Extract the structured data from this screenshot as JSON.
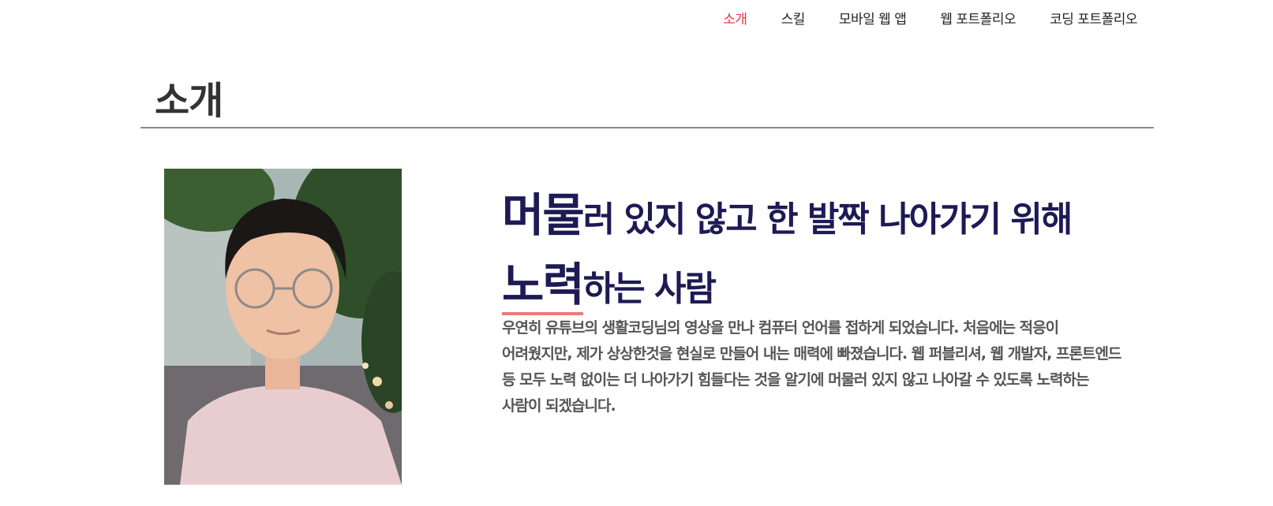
{
  "nav": {
    "items": [
      {
        "label": "소개",
        "active": true
      },
      {
        "label": "스킬",
        "active": false
      },
      {
        "label": "모바일 웹 앱",
        "active": false
      },
      {
        "label": "웹 포트폴리오",
        "active": false
      },
      {
        "label": "코딩 포트폴리오",
        "active": false
      }
    ],
    "active_color": "#e8303f"
  },
  "section": {
    "title": "소개"
  },
  "intro": {
    "headline_line1_emphasis": "머물",
    "headline_line1_rest": "러 있지 않고 한 발짝 나아가기 위해",
    "headline_line2_emphasis": "노력",
    "headline_line2_rest": "하는 사람",
    "headline_color": "#1d1a55",
    "underline_color": "#ec7a7c",
    "description": "우연히 유튜브의 생활코딩님의 영상을 만나 컴퓨터 언어를 접하게 되었습니다. 처음에는 적응이 어려웠지만, 제가 상상한것을 현실로 만들어 내는 매력에 빠졌습니다. 웹 퍼블리셔, 웹 개발자, 프론트엔드 등 모두 노력 없이는 더 나아가기 힘들다는 것을 알기에 머물러 있지 않고 나아갈 수 있도록 노력하는 사람이 되겠습니다."
  }
}
